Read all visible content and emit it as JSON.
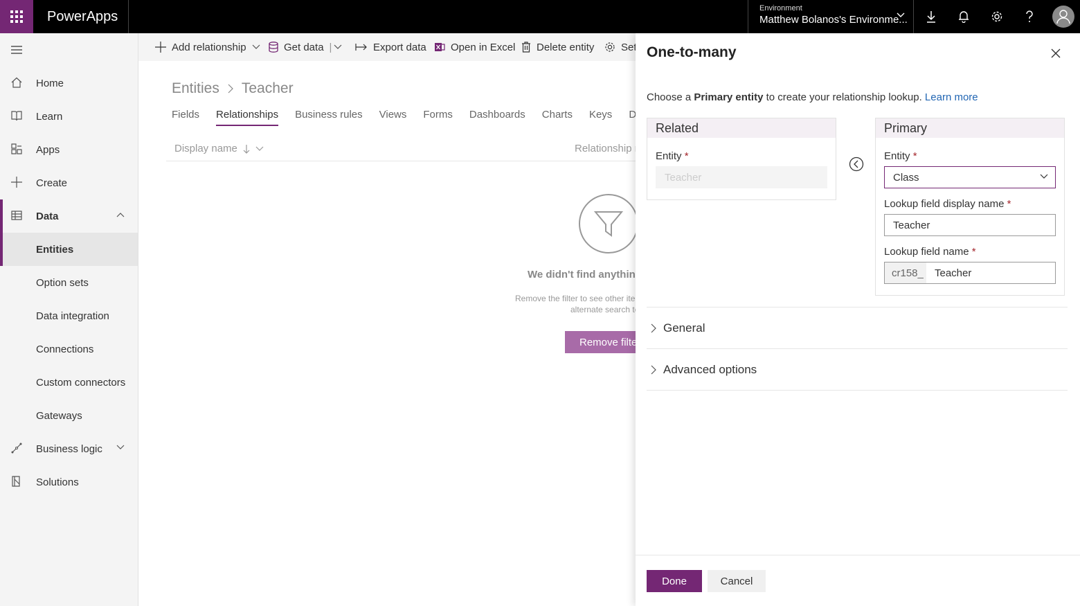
{
  "app": {
    "brand": "PowerApps"
  },
  "environment": {
    "label": "Environment",
    "name": "Matthew Bolanos's Environme..."
  },
  "topbar_icons": [
    "waffle-icon",
    "download-icon",
    "bell-icon",
    "gear-icon",
    "help-icon",
    "user-icon"
  ],
  "nav": {
    "home": "Home",
    "learn": "Learn",
    "apps": "Apps",
    "create": "Create",
    "data": "Data",
    "entities": "Entities",
    "option_sets": "Option sets",
    "data_integration": "Data integration",
    "connections": "Connections",
    "custom_connectors": "Custom connectors",
    "gateways": "Gateways",
    "business_logic": "Business logic",
    "solutions": "Solutions"
  },
  "commands": {
    "add_relationship": "Add relationship",
    "get_data": "Get data",
    "export_data": "Export data",
    "open_in_excel": "Open in Excel",
    "delete_entity": "Delete entity",
    "settings": "Set"
  },
  "breadcrumb": {
    "root": "Entities",
    "current": "Teacher"
  },
  "tabs": [
    "Fields",
    "Relationships",
    "Business rules",
    "Views",
    "Forms",
    "Dashboards",
    "Charts",
    "Keys",
    "Data"
  ],
  "active_tab": "Relationships",
  "columns": {
    "display_name": "Display name",
    "relationship_name": "Relationship n"
  },
  "empty": {
    "title": "We didn't find anything",
    "line1": "Remove the filter to see other ite",
    "line2": "alternate search te",
    "button": "Remove filter"
  },
  "panel": {
    "title": "One-to-many",
    "desc_prefix": "Choose a ",
    "desc_bold": "Primary entity",
    "desc_suffix": " to create your relationship lookup.",
    "learn_more": "Learn more",
    "related": {
      "header": "Related",
      "entity_label": "Entity",
      "entity_value": "Teacher"
    },
    "primary": {
      "header": "Primary",
      "entity_label": "Entity",
      "entity_value": "Class",
      "lookup_display_label": "Lookup field display name",
      "lookup_display_value": "Teacher",
      "lookup_name_label": "Lookup field name",
      "lookup_name_prefix": "cr158_",
      "lookup_name_value": "Teacher"
    },
    "required_mark": "*",
    "sections": {
      "general": "General",
      "advanced": "Advanced options"
    },
    "done": "Done",
    "cancel": "Cancel"
  },
  "colors": {
    "accent": "#742774",
    "link": "#2266b3",
    "topbar": "#000000"
  }
}
